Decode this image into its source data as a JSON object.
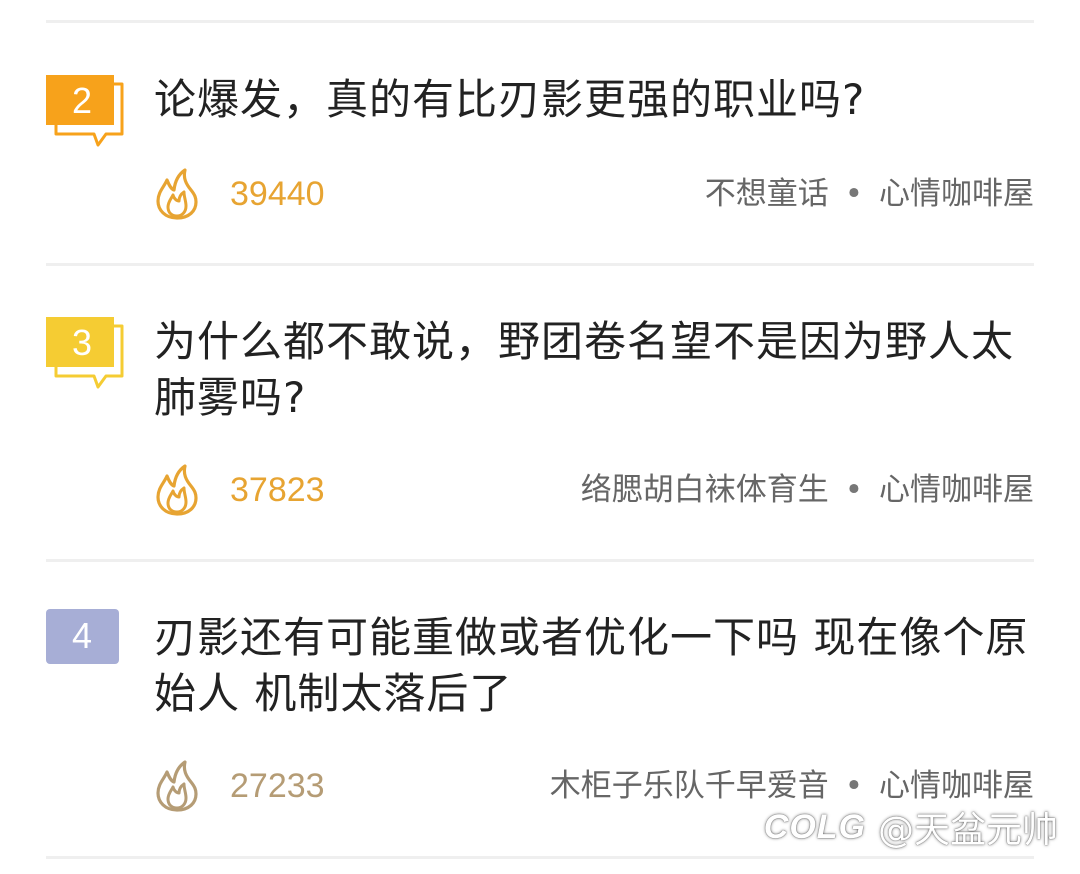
{
  "items": [
    {
      "rank": "2",
      "title": "论爆发，真的有比刃影更强的职业吗?",
      "heat": "39440",
      "author": "不想童话",
      "separator": "•",
      "board": "心情咖啡屋"
    },
    {
      "rank": "3",
      "title": "为什么都不敢说，野团卷名望不是因为野人太肺雾吗?",
      "heat": "37823",
      "author": "络腮胡白袜体育生",
      "separator": "•",
      "board": "心情咖啡屋"
    },
    {
      "rank": "4",
      "title": "刃影还有可能重做或者优化一下吗 现在像个原始人 机制太落后了",
      "heat": "27233",
      "author": "木柜子乐队千早爱音",
      "separator": "•",
      "board": "心情咖啡屋"
    }
  ],
  "colors": {
    "rank2_badge": "#f7a21b",
    "rank3_badge": "#f5cc33",
    "rank4_badge": "#a7aed6",
    "hot_count": "#e7a432",
    "normal_count": "#b59c75",
    "title_text": "#222222",
    "meta_text": "#666666"
  },
  "icons": {
    "heat": "flame-icon",
    "badge": "speech-bubble-badge-icon"
  },
  "watermark": {
    "logo": "COLG",
    "handle": "@天盆元帅"
  }
}
